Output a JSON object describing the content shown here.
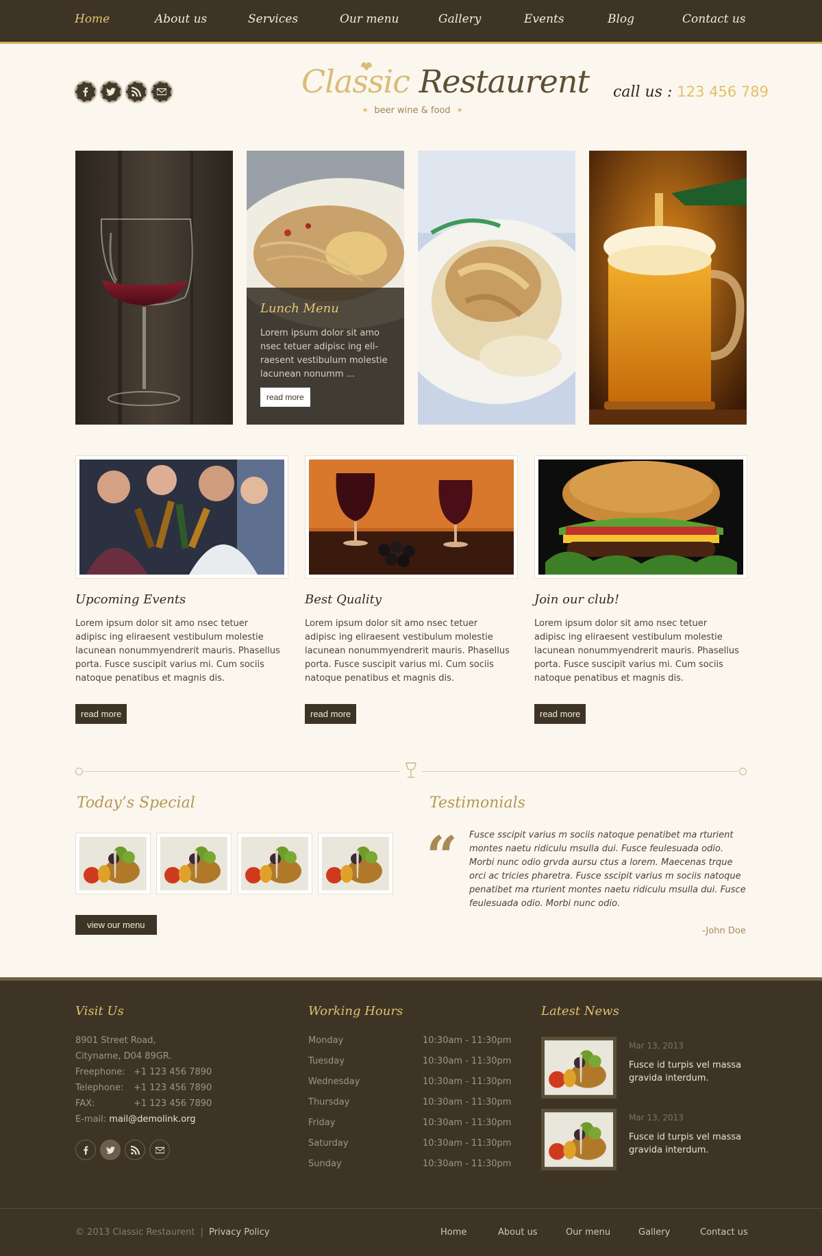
{
  "nav": {
    "items": [
      "Home",
      "About us",
      "Services",
      "Our menu",
      "Gallery",
      "Events",
      "Blog",
      "Contact us"
    ],
    "active": "Home"
  },
  "header": {
    "logo_classic": "Classic",
    "logo_restaurent": "Restaurent",
    "tagline": "beer wine & food",
    "call_label": "call us :",
    "call_number": "123 456 789",
    "social_icons": [
      "facebook-icon",
      "twitter-icon",
      "rss-icon",
      "mail-icon"
    ]
  },
  "hero": {
    "lunch_title": "Lunch Menu",
    "lunch_text": "Lorem ipsum dolor sit amo nsec tetuer adipisc ing eli-raesent vestibulum molestie lacunean nonumm ...",
    "lunch_button": "read more"
  },
  "features": [
    {
      "title": "Upcoming Events",
      "text": "Lorem ipsum dolor sit amo nsec tetuer adipisc ing eliraesent vestibulum molestie lacunean nonummyendrerit mauris. Phasellus porta. Fusce suscipit varius mi. Cum sociis natoque penatibus et magnis dis.",
      "button": "read more"
    },
    {
      "title": "Best Quality",
      "text": "Lorem ipsum dolor sit amo nsec tetuer adipisc ing eliraesent vestibulum molestie lacunean nonummyendrerit mauris. Phasellus porta. Fusce suscipit varius mi. Cum sociis natoque penatibus et magnis dis.",
      "button": "read more"
    },
    {
      "title": "Join our club!",
      "text": "Lorem ipsum dolor sit amo nsec tetuer adipisc ing eliraesent vestibulum molestie lacunean nonummyendrerit mauris. Phasellus porta. Fusce suscipit varius mi. Cum sociis natoque penatibus et magnis dis.",
      "button": "read more"
    }
  ],
  "special": {
    "title": "Today’s Special",
    "button": "view our menu"
  },
  "testimonials": {
    "title": "Testimonials",
    "quote": "Fusce sscipit varius m sociis natoque penatibet ma rturient montes naetu ridiculu msulla dui. Fusce feulesuada odio. Morbi nunc odio grvda aursu ctus a lorem. Maecenas trque orci ac tricies pharetra. Fusce sscipit varius m sociis natoque penatibet ma rturient montes naetu ridiculu msulla dui. Fusce feulesuada odio. Morbi nunc odio.",
    "author": "-John Doe"
  },
  "footer": {
    "visit": {
      "title": "Visit Us",
      "address1": "8901 Street Road,",
      "address2": "Cityname, D04 89GR.",
      "freephone_label": "Freephone:",
      "freephone": "+1 123 456 7890",
      "telephone_label": "Telephone:",
      "telephone": "+1 123 456 7890",
      "fax_label": "FAX:",
      "fax": "+1 123 456 7890",
      "email_label": "E-mail:",
      "email": "mail@demolink.org"
    },
    "hours": {
      "title": "Working Hours",
      "rows": [
        {
          "day": "Monday",
          "time": "10:30am - 11:30pm"
        },
        {
          "day": "Tuesday",
          "time": "10:30am - 11:30pm"
        },
        {
          "day": "Wednesday",
          "time": "10:30am - 11:30pm"
        },
        {
          "day": "Thursday",
          "time": "10:30am - 11:30pm"
        },
        {
          "day": "Friday",
          "time": "10:30am - 11:30pm"
        },
        {
          "day": "Saturday",
          "time": "10:30am - 11:30pm"
        },
        {
          "day": "Sunday",
          "time": "10:30am - 11:30pm"
        }
      ]
    },
    "news": {
      "title": "Latest News",
      "items": [
        {
          "date": "Mar 13, 2013",
          "text": "Fusce id turpis vel massa gravida interdum."
        },
        {
          "date": "Mar 13, 2013",
          "text": "Fusce id turpis vel massa gravida interdum."
        }
      ]
    },
    "copyright": "© 2013 Classic Restaurent",
    "separator": "|",
    "privacy": "Privacy Policy",
    "bottom_links": [
      "Home",
      "About us",
      "Our menu",
      "Gallery",
      "Contact us"
    ]
  },
  "colors": {
    "dark": "#3d3426",
    "gold": "#e2c06a",
    "cream": "#fbf7ef"
  }
}
